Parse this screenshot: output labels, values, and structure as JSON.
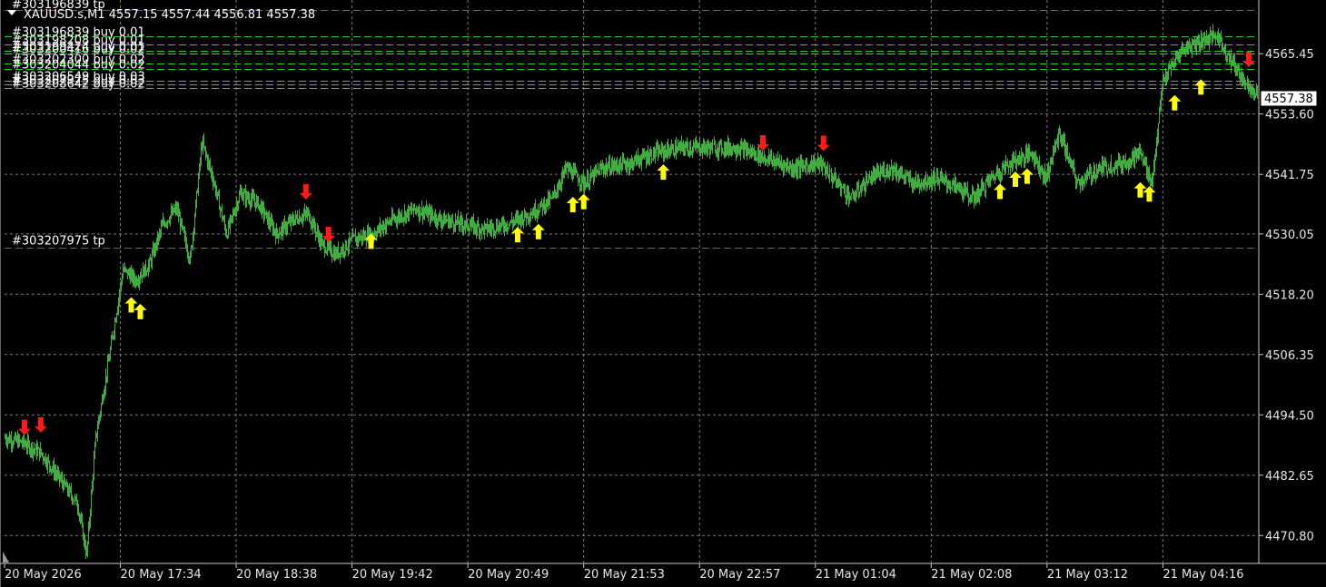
{
  "window": {
    "symbol_info": "XAUUSD.s,M1  4557.15 4557.44 4556.81 4557.38",
    "top_order_label": "#303196839 tp",
    "current_price": "4557.38"
  },
  "colors": {
    "background": "#000000",
    "candle": "#3fae3f",
    "grid": "#7a7a7a",
    "buy_line": "#2fd12f",
    "tp_line": "#e03030",
    "buy_arrow": "#ffff00",
    "sell_arrow": "#ff1a1a"
  },
  "orders": [
    {
      "label": "#303196839 buy 0.01",
      "price": 4568.9
    },
    {
      "label": "#303198208 buy 0.01",
      "price": 4567.3
    },
    {
      "label": "#303199424 buy 0.01",
      "price": 4566.1
    },
    {
      "label": "#303200416 buy 0.02",
      "price": 4565.5
    },
    {
      "label": "#303202300 buy 0.02",
      "price": 4563.6
    },
    {
      "label": "#303204044 buy 0.02",
      "price": 4562.4
    },
    {
      "label": "#303206549 buy 0.03",
      "price": 4560.1
    },
    {
      "label": "#303207975 buy 0.03",
      "price": 4559.5
    },
    {
      "label": "#303208642 buy 0.02",
      "price": 4558.8
    }
  ],
  "tp_lines": [
    {
      "label": "#303196839 tp",
      "price": 4574.0
    },
    {
      "label": "#303207975 tp",
      "price": 4527.3
    }
  ],
  "chart_data": {
    "type": "bar",
    "symbol": "XAUUSD.s",
    "timeframe": "M1",
    "ylim": [
      4465.5,
      4576.0
    ],
    "yticks": [
      "4565.45",
      "4553.60",
      "4541.75",
      "4530.05",
      "4518.20",
      "4506.35",
      "4494.50",
      "4482.65",
      "4470.80"
    ],
    "ytick_values": [
      4565.45,
      4553.6,
      4541.75,
      4530.05,
      4518.2,
      4506.35,
      4494.5,
      4482.65,
      4470.8
    ],
    "xtick_labels": [
      "20 May 2026",
      "20 May 17:34",
      "20 May 18:38",
      "20 May 19:42",
      "20 May 20:49",
      "20 May 21:53",
      "20 May 22:57",
      "21 May 01:04",
      "21 May 02:08",
      "21 May 03:12",
      "21 May 04:16"
    ],
    "xtick_index": [
      0,
      128,
      256,
      384,
      512,
      640,
      768,
      896,
      1024,
      1152,
      1280
    ],
    "bar_count": 1385,
    "close_path": [
      [
        0,
        4490.0
      ],
      [
        20,
        4489.0
      ],
      [
        40,
        4487.0
      ],
      [
        60,
        4482.0
      ],
      [
        80,
        4477.0
      ],
      [
        90,
        4467.0
      ],
      [
        100,
        4490.0
      ],
      [
        115,
        4506.0
      ],
      [
        130,
        4523.0
      ],
      [
        145,
        4521.0
      ],
      [
        160,
        4524.0
      ],
      [
        175,
        4532.0
      ],
      [
        190,
        4535.0
      ],
      [
        205,
        4525.0
      ],
      [
        218,
        4548.0
      ],
      [
        230,
        4541.0
      ],
      [
        245,
        4530.0
      ],
      [
        260,
        4538.0
      ],
      [
        280,
        4536.0
      ],
      [
        300,
        4530.0
      ],
      [
        320,
        4533.0
      ],
      [
        335,
        4534.0
      ],
      [
        350,
        4528.0
      ],
      [
        365,
        4526.0
      ],
      [
        385,
        4529.0
      ],
      [
        405,
        4530.0
      ],
      [
        430,
        4533.0
      ],
      [
        455,
        4535.0
      ],
      [
        480,
        4533.0
      ],
      [
        505,
        4532.0
      ],
      [
        530,
        4531.0
      ],
      [
        555,
        4532.0
      ],
      [
        580,
        4534.0
      ],
      [
        605,
        4537.0
      ],
      [
        620,
        4543.0
      ],
      [
        640,
        4540.0
      ],
      [
        660,
        4543.0
      ],
      [
        690,
        4544.0
      ],
      [
        720,
        4546.0
      ],
      [
        750,
        4547.0
      ],
      [
        780,
        4547.0
      ],
      [
        810,
        4547.0
      ],
      [
        840,
        4545.0
      ],
      [
        870,
        4543.0
      ],
      [
        900,
        4544.0
      ],
      [
        915,
        4541.0
      ],
      [
        935,
        4537.0
      ],
      [
        955,
        4541.0
      ],
      [
        980,
        4543.0
      ],
      [
        1005,
        4540.0
      ],
      [
        1030,
        4541.0
      ],
      [
        1055,
        4539.0
      ],
      [
        1070,
        4537.0
      ],
      [
        1090,
        4541.0
      ],
      [
        1110,
        4544.0
      ],
      [
        1135,
        4546.0
      ],
      [
        1150,
        4541.0
      ],
      [
        1165,
        4550.0
      ],
      [
        1185,
        4540.0
      ],
      [
        1210,
        4543.0
      ],
      [
        1235,
        4544.0
      ],
      [
        1255,
        4546.0
      ],
      [
        1268,
        4540.0
      ],
      [
        1280,
        4560.0
      ],
      [
        1300,
        4566.0
      ],
      [
        1320,
        4568.0
      ],
      [
        1340,
        4569.0
      ],
      [
        1355,
        4564.0
      ],
      [
        1370,
        4560.0
      ],
      [
        1385,
        4557.38
      ]
    ],
    "buy_arrows": [
      {
        "bar": 140,
        "price": 4517.8
      },
      {
        "bar": 150,
        "price": 4516.5
      },
      {
        "bar": 405,
        "price": 4530.3
      },
      {
        "bar": 567,
        "price": 4531.6
      },
      {
        "bar": 590,
        "price": 4532.2
      },
      {
        "bar": 628,
        "price": 4537.5
      },
      {
        "bar": 640,
        "price": 4538.1
      },
      {
        "bar": 728,
        "price": 4543.9
      },
      {
        "bar": 1100,
        "price": 4540.1
      },
      {
        "bar": 1117,
        "price": 4542.5
      },
      {
        "bar": 1130,
        "price": 4543.1
      },
      {
        "bar": 1255,
        "price": 4540.4
      },
      {
        "bar": 1265,
        "price": 4539.6
      },
      {
        "bar": 1293,
        "price": 4557.5
      },
      {
        "bar": 1322,
        "price": 4560.6
      }
    ],
    "sell_arrows": [
      {
        "bar": 22,
        "price": 4490.7
      },
      {
        "bar": 40,
        "price": 4491.2
      },
      {
        "bar": 333,
        "price": 4537.0
      },
      {
        "bar": 358,
        "price": 4528.6
      },
      {
        "bar": 838,
        "price": 4546.6
      },
      {
        "bar": 905,
        "price": 4546.5
      },
      {
        "bar": 1375,
        "price": 4563.0
      }
    ]
  }
}
